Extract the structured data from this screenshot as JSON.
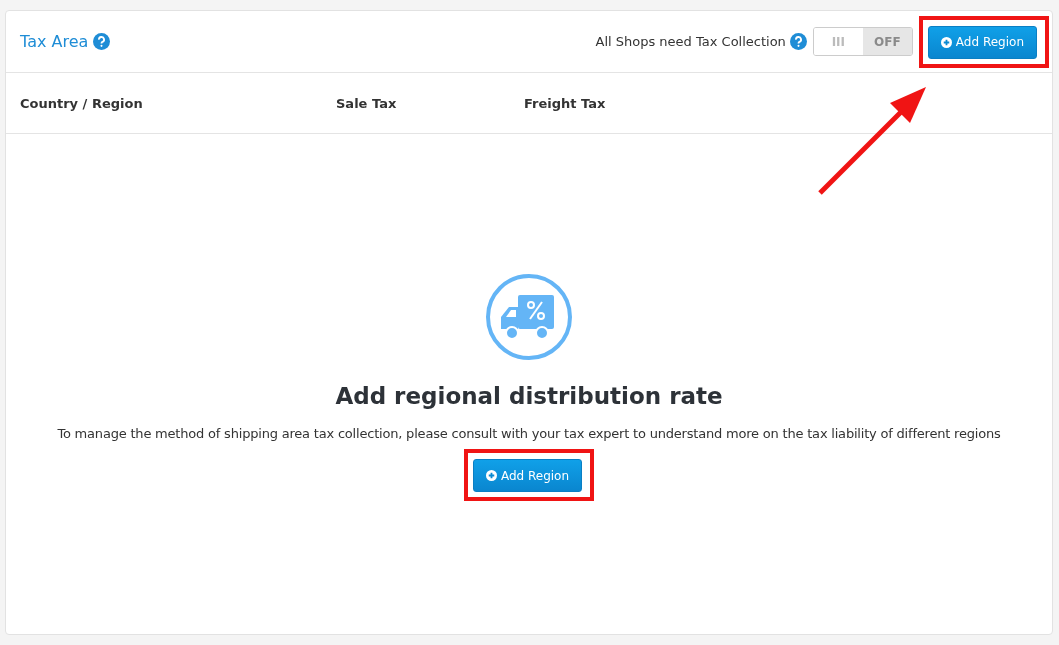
{
  "header": {
    "title": "Tax Area",
    "tax_collection_label": "All Shops need Tax Collection",
    "toggle": {
      "on": false,
      "handle": "III",
      "label": "OFF"
    },
    "add_button": {
      "label": "Add Region",
      "highlighted": true
    }
  },
  "table": {
    "columns": [
      "Country / Region",
      "Sale Tax",
      "Freight Tax"
    ]
  },
  "empty_state": {
    "title": "Add regional distribution rate",
    "message": "To manage the method of shipping area tax collection, please consult with your tax expert to understand more on the tax liability of different regions",
    "add_button": {
      "label": "Add Region",
      "highlighted": true
    }
  }
}
